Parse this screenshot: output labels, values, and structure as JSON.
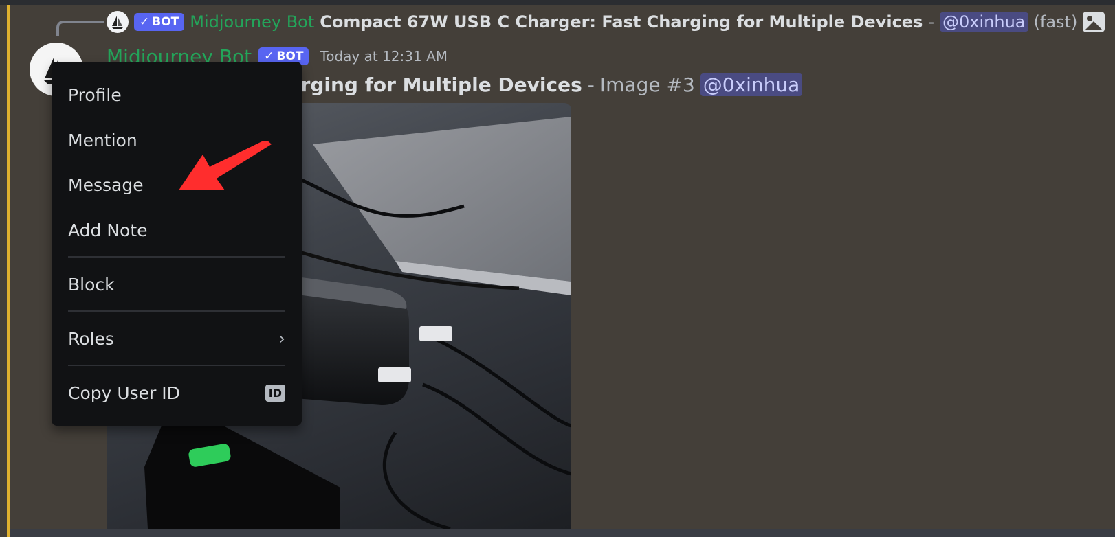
{
  "reply": {
    "bot_tag": "BOT",
    "author": "Midjourney Bot",
    "prompt": "Compact 67W USB C Charger: Fast Charging for Multiple Devices",
    "separator": "-",
    "mention": "@0xinhua",
    "mode": "(fast)",
    "icon": "image-icon"
  },
  "message": {
    "author": "Midjourney Bot",
    "bot_tag": "BOT",
    "timestamp": "Today at 12:31 AM",
    "prompt_visible": "Charger: Fast Charging for Multiple Devices",
    "separator": "-",
    "image_label": "Image #3",
    "mention": "@0xinhua"
  },
  "attachment": {
    "icon": "charger-photo"
  },
  "context_menu": {
    "items": [
      {
        "label": "Profile"
      },
      {
        "label": "Mention"
      },
      {
        "label": "Message"
      },
      {
        "label": "Add Note"
      },
      {
        "label": "Block"
      },
      {
        "label": "Roles"
      },
      {
        "label": "Copy User ID"
      }
    ],
    "id_badge": "ID"
  },
  "colors": {
    "accent_bot": "#5865f2",
    "author_green": "#23a55a",
    "mention_bg": "#4a4b82",
    "highlight_bar": "#e0b12f",
    "arrow": "#ff2d2d"
  }
}
